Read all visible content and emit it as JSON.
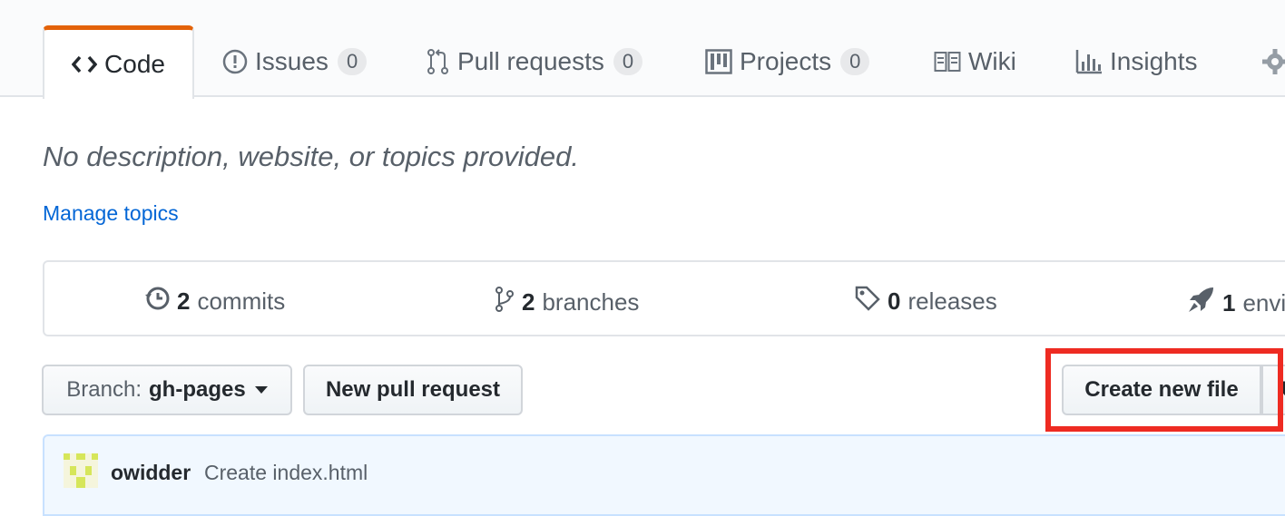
{
  "tabs": [
    {
      "label": "Code",
      "icon": "code-icon",
      "count": null,
      "selected": true
    },
    {
      "label": "Issues",
      "icon": "issue-icon",
      "count": "0"
    },
    {
      "label": "Pull requests",
      "icon": "pull-request-icon",
      "count": "0"
    },
    {
      "label": "Projects",
      "icon": "project-icon",
      "count": "0"
    },
    {
      "label": "Wiki",
      "icon": "book-icon",
      "count": null
    },
    {
      "label": "Insights",
      "icon": "graph-icon",
      "count": null
    }
  ],
  "repo": {
    "description": "No description, website, or topics provided.",
    "manage_topics": "Manage topics"
  },
  "summary": {
    "commits": {
      "count": "2",
      "label": "commits"
    },
    "branches": {
      "count": "2",
      "label": "branches"
    },
    "releases": {
      "count": "0",
      "label": "releases"
    },
    "environments": {
      "count": "1",
      "label": "envi"
    }
  },
  "toolbar": {
    "branch_label": "Branch:",
    "branch_value": "gh-pages",
    "new_pull_request": "New pull request",
    "create_new_file": "Create new file",
    "upload_partial": "U"
  },
  "commit": {
    "author": "owidder",
    "message": "Create index.html"
  },
  "colors": {
    "accent_tab": "#e36209",
    "link": "#0366d6",
    "highlight": "#ee2b22",
    "commit_bg": "#f1f8ff"
  }
}
